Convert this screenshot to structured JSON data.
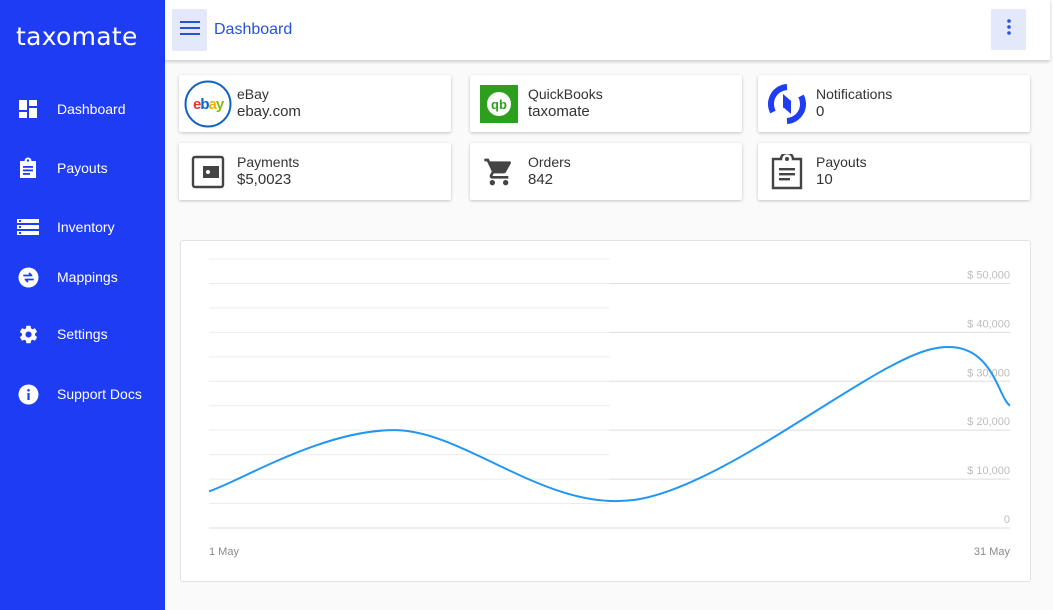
{
  "app": {
    "logo_text": "taxomate"
  },
  "sidebar": {
    "items": [
      {
        "label": "Dashboard",
        "icon": "dashboard-icon"
      },
      {
        "label": "Payouts",
        "icon": "clipboard-icon"
      },
      {
        "label": "Inventory",
        "icon": "list-icon"
      },
      {
        "label": "Mappings",
        "icon": "swap-icon"
      },
      {
        "label": "Settings",
        "icon": "gear-icon"
      },
      {
        "label": "Support Docs",
        "icon": "info-icon"
      }
    ]
  },
  "topbar": {
    "title": "Dashboard"
  },
  "cards": [
    {
      "title": "eBay",
      "value": "ebay.com",
      "icon": "ebay-logo-icon"
    },
    {
      "title": "QuickBooks",
      "value": "taxomate",
      "icon": "quickbooks-logo-icon"
    },
    {
      "title": "Notifications",
      "value": "0",
      "icon": "sync-icon"
    },
    {
      "title": "Payments",
      "value": "$5,0023",
      "icon": "wallet-icon"
    },
    {
      "title": "Orders",
      "value": "842",
      "icon": "cart-icon"
    },
    {
      "title": "Payouts",
      "value": "10",
      "icon": "clipboard-icon"
    }
  ],
  "colors": {
    "sidebar": "#1d3cf4",
    "accent": "#2652d6",
    "line": "#2196f3",
    "quickbooks": "#2ca01c"
  },
  "chart_data": {
    "type": "line",
    "x_labels": [
      "1 May",
      "31 May"
    ],
    "y_tick_labels": [
      "$ 50,000",
      "$ 40,000",
      "$ 30,000",
      "$ 20,000",
      "$ 10,000",
      "0"
    ],
    "y_ticks": [
      50000,
      40000,
      30000,
      20000,
      10000,
      0
    ],
    "ylim": [
      0,
      55000
    ],
    "y_axis_position": "right",
    "grid": true,
    "series": [
      {
        "x": [
          1,
          8,
          17,
          28,
          31
        ],
        "values": [
          7500,
          20000,
          5800,
          36500,
          25000
        ]
      }
    ]
  }
}
